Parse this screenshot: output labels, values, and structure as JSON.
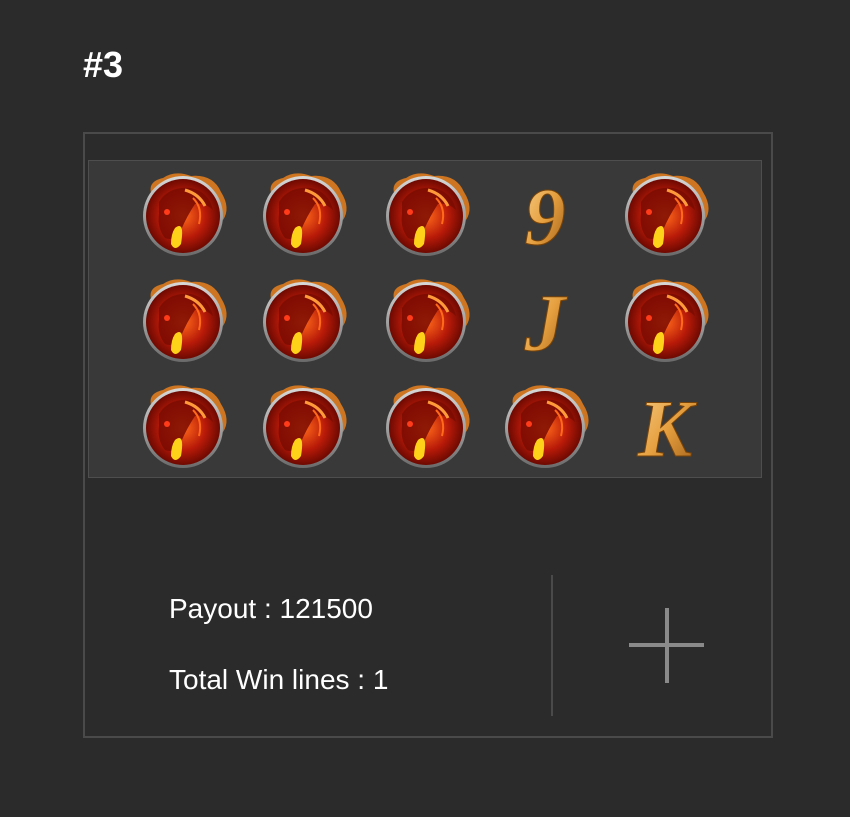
{
  "heading": "#3",
  "reels": {
    "rows": [
      [
        "horse-icon",
        "nine-icon",
        "horse-icon",
        "nine-icon",
        "horse-icon"
      ],
      [
        "horse-icon",
        "horse-icon",
        "horse-icon",
        "j-icon",
        "horse-icon"
      ],
      [
        "horse-icon",
        "horse-icon",
        "horse-icon",
        "horse-icon",
        "k-icon"
      ]
    ]
  },
  "symbols": {
    "nine": "9",
    "j": "J",
    "k": "K"
  },
  "payout": {
    "text": "Payout : 121500"
  },
  "win_lines": {
    "text": "Total Win lines : 1"
  },
  "add_button": {
    "icon": "plus-icon"
  },
  "colors": {
    "background": "#2b2b2b",
    "reel_background": "#393939",
    "gold": "#e6a040",
    "fire_red": "#c0200a"
  }
}
